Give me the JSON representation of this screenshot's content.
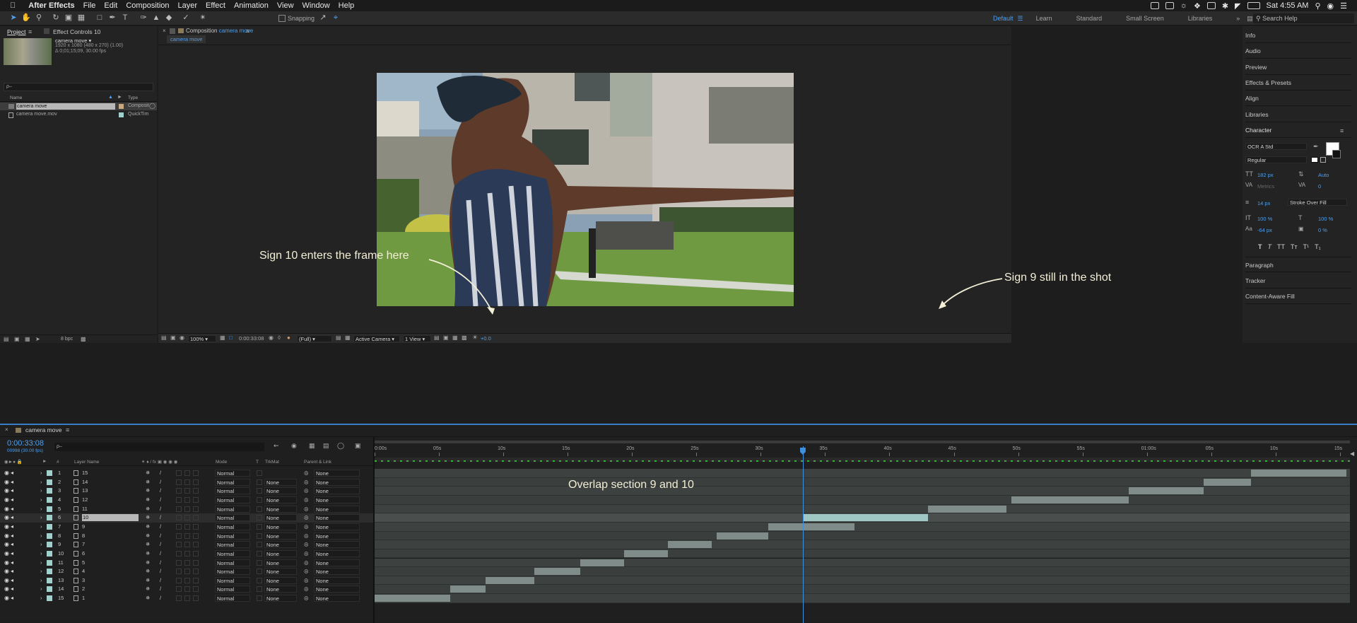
{
  "menubar": {
    "app_name": "After Effects",
    "items": [
      "File",
      "Edit",
      "Composition",
      "Layer",
      "Effect",
      "Animation",
      "View",
      "Window",
      "Help"
    ],
    "clock": "Sat 4:55 AM"
  },
  "toolbar": {
    "snapping_label": "Snapping",
    "workspaces": [
      "Default",
      "Learn",
      "Standard",
      "Small Screen",
      "Libraries"
    ],
    "search_placeholder": "Search Help"
  },
  "project_panel": {
    "tab_project": "Project",
    "tab_effect_controls": "Effect Controls 10",
    "selected_item": "camera move ▾",
    "selected_info_1": "1920 x 1080  (480 x 270) (1.00)",
    "selected_info_2": "Δ 0;01;15;09, 30.00 fps",
    "search_placeholder": "ρ–",
    "col_name": "Name",
    "col_type": "Type",
    "items": [
      {
        "name": "camera move",
        "type": "Composit"
      },
      {
        "name": "camera move.mov",
        "type": "QuickTim"
      }
    ],
    "bpc": "8 bpc"
  },
  "composition_panel": {
    "tab_label": "Composition",
    "comp_name": "camera move",
    "flow_tab": "camera move",
    "zoom": "100%",
    "timecode": "0:00:33:08",
    "resolution": "(Full)",
    "camera": "Active Camera",
    "views": "1 View",
    "exposure": "+0.0"
  },
  "annotations": {
    "sign10": "Sign 10 enters the frame here",
    "sign9": "Sign 9 still in the shot",
    "overlap": "Overlap section 9 and 10"
  },
  "right_panels": {
    "items": [
      "Info",
      "Audio",
      "Preview",
      "Effects & Presets",
      "Align",
      "Libraries"
    ],
    "character_title": "Character",
    "font_family": "OCR A Std",
    "font_style": "Regular",
    "font_size": "182 px",
    "leading": "Auto",
    "kerning": "Metrics",
    "tracking": "0",
    "stroke_width": "14 px",
    "stroke_type": "Stroke Over Fill",
    "vscale": "100 %",
    "hscale": "100 %",
    "baseline": "-64 px",
    "tsume": "0 %",
    "type_buttons": [
      "T",
      "T",
      "TT",
      "Tт",
      "T¹",
      "T₁"
    ],
    "lower_items": [
      "Paragraph",
      "Tracker",
      "Content-Aware Fill"
    ]
  },
  "timeline": {
    "tab_label": "camera move",
    "timecode": "0:00:33:08",
    "frame_info": "00998 (30.00 fps)",
    "search_placeholder": "ρ–",
    "col_num": "#",
    "col_layer_name": "Layer Name",
    "col_mode": "Mode",
    "col_t": "T",
    "col_trkmat": "TrkMat",
    "col_parent": "Parent & Link",
    "ruler_labels": [
      "0:00s",
      "05s",
      "10s",
      "15s",
      "20s",
      "25s",
      "30s",
      "35s",
      "40s",
      "45s",
      "50s",
      "55s",
      "01:00s",
      "05s",
      "10s",
      "15s"
    ],
    "playhead_seconds": 33.27,
    "layers": [
      {
        "num": "1",
        "name": "15",
        "mode": "Normal",
        "trkmat": "",
        "parent": "None",
        "start": 68.1,
        "end": 75.5
      },
      {
        "num": "2",
        "name": "14",
        "mode": "Normal",
        "trkmat": "None",
        "parent": "None",
        "start": 64.4,
        "end": 68.1
      },
      {
        "num": "3",
        "name": "13",
        "mode": "Normal",
        "trkmat": "None",
        "parent": "None",
        "start": 58.6,
        "end": 64.4
      },
      {
        "num": "4",
        "name": "12",
        "mode": "Normal",
        "trkmat": "None",
        "parent": "None",
        "start": 49.5,
        "end": 58.6
      },
      {
        "num": "5",
        "name": "11",
        "mode": "Normal",
        "trkmat": "None",
        "parent": "None",
        "start": 43.0,
        "end": 49.1
      },
      {
        "num": "6",
        "name": "10",
        "mode": "Normal",
        "trkmat": "None",
        "parent": "None",
        "start": 33.3,
        "end": 43.0
      },
      {
        "num": "7",
        "name": "9",
        "mode": "Normal",
        "trkmat": "None",
        "parent": "None",
        "start": 30.6,
        "end": 37.3
      },
      {
        "num": "8",
        "name": "8",
        "mode": "Normal",
        "trkmat": "None",
        "parent": "None",
        "start": 26.6,
        "end": 30.6
      },
      {
        "num": "9",
        "name": "7",
        "mode": "Normal",
        "trkmat": "None",
        "parent": "None",
        "start": 22.8,
        "end": 26.2
      },
      {
        "num": "10",
        "name": "6",
        "mode": "Normal",
        "trkmat": "None",
        "parent": "None",
        "start": 19.4,
        "end": 22.8
      },
      {
        "num": "11",
        "name": "5",
        "mode": "Normal",
        "trkmat": "None",
        "parent": "None",
        "start": 16.0,
        "end": 19.4
      },
      {
        "num": "12",
        "name": "4",
        "mode": "Normal",
        "trkmat": "None",
        "parent": "None",
        "start": 12.4,
        "end": 16.0
      },
      {
        "num": "13",
        "name": "3",
        "mode": "Normal",
        "trkmat": "None",
        "parent": "None",
        "start": 8.6,
        "end": 12.4
      },
      {
        "num": "14",
        "name": "2",
        "mode": "Normal",
        "trkmat": "None",
        "parent": "None",
        "start": 5.9,
        "end": 8.6
      },
      {
        "num": "15",
        "name": "1",
        "mode": "Normal",
        "trkmat": "None",
        "parent": "None",
        "start": 0.0,
        "end": 5.9
      }
    ],
    "selected_layer_index": 5
  }
}
